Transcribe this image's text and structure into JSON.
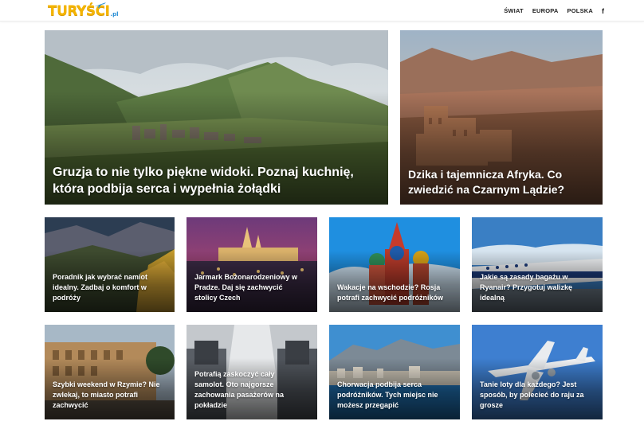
{
  "header": {
    "logo_text": "TURYŚCI",
    "logo_suffix": ".pl",
    "nav": [
      "ŚWIAT",
      "EUROPA",
      "POLSKA"
    ],
    "social_icon": "facebook-icon",
    "social_glyph": "f"
  },
  "featured": [
    {
      "title": "Gruzja to nie tylko piękne widoki. Poznaj kuchnię, która podbija serca i wypełnia żołądki"
    },
    {
      "title": "Dzika i tajemnicza Afryka. Co zwiedzić na Czarnym Lądzie?"
    }
  ],
  "articles": [
    {
      "title": "Poradnik jak wybrać namiot idealny. Zadbaj o komfort w podróży"
    },
    {
      "title": "Jarmark Bożonarodzeniowy w Pradze. Daj się zachwycić stolicy Czech"
    },
    {
      "title": "Wakacje na wschodzie? Rosja potrafi zachwycić podróżników"
    },
    {
      "title": "Jakie są zasady bagażu w Ryanair? Przygotuj walizkę idealną"
    },
    {
      "title": "Szybki weekend w Rzymie? Nie zwlekaj, to miasto potrafi zachwycić"
    },
    {
      "title": "Potrafią zaskoczyć cały samolot. Oto najgorsze zachowania pasażerów na pokładzie"
    },
    {
      "title": "Chorwacja podbija serca podróżników. Tych miejsc nie możesz przegapić"
    },
    {
      "title": "Tanie loty dla każdego? Jest sposób, by polecieć do raju za grosze"
    }
  ],
  "colors": {
    "logo_yellow": "#f4b400",
    "logo_blue": "#2a8fd6",
    "nav_text": "#222222",
    "caption_text": "#ffffff"
  }
}
